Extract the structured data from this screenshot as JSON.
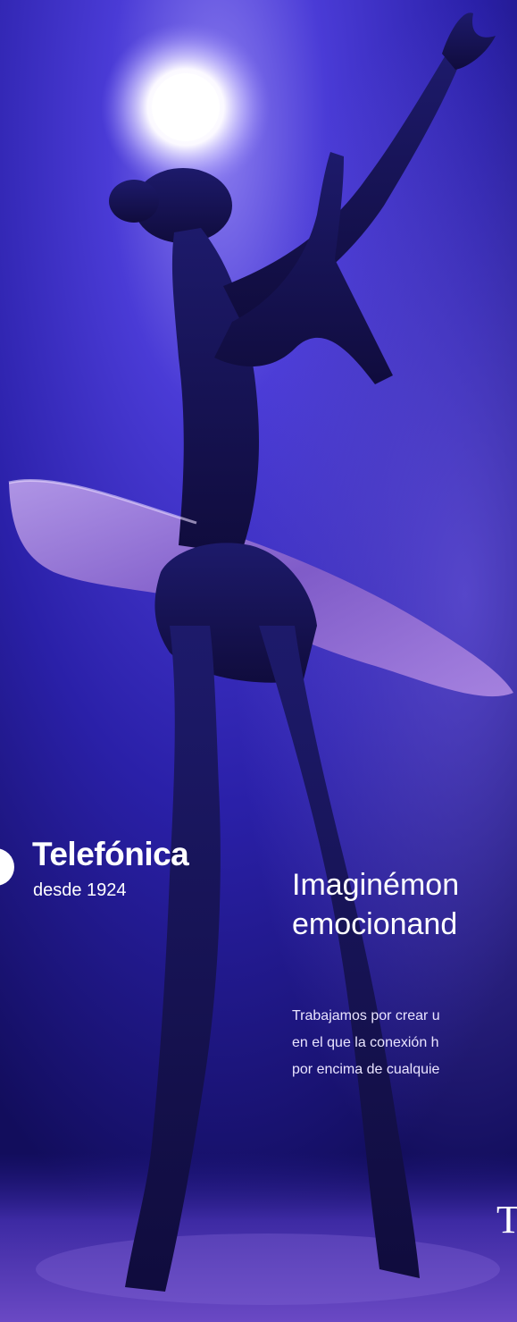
{
  "brand": {
    "name": "Telefónica",
    "tagline": "desde 1924"
  },
  "hero": {
    "headline_line1": "Imaginémon",
    "headline_line2": "emocionand",
    "body_line1": "Trabajamos por crear u",
    "body_line2": "en el que la conexión h",
    "body_line3": "por encima de cualquie",
    "trailing_mark": "T"
  },
  "colors": {
    "background_deep": "#15106a",
    "background_mid": "#3b2fc4",
    "spotlight": "#ffffff",
    "tutu": "#a77fd8",
    "text": "#ffffff"
  },
  "icons": {
    "brand_mark": "telefonica-logo-icon"
  }
}
